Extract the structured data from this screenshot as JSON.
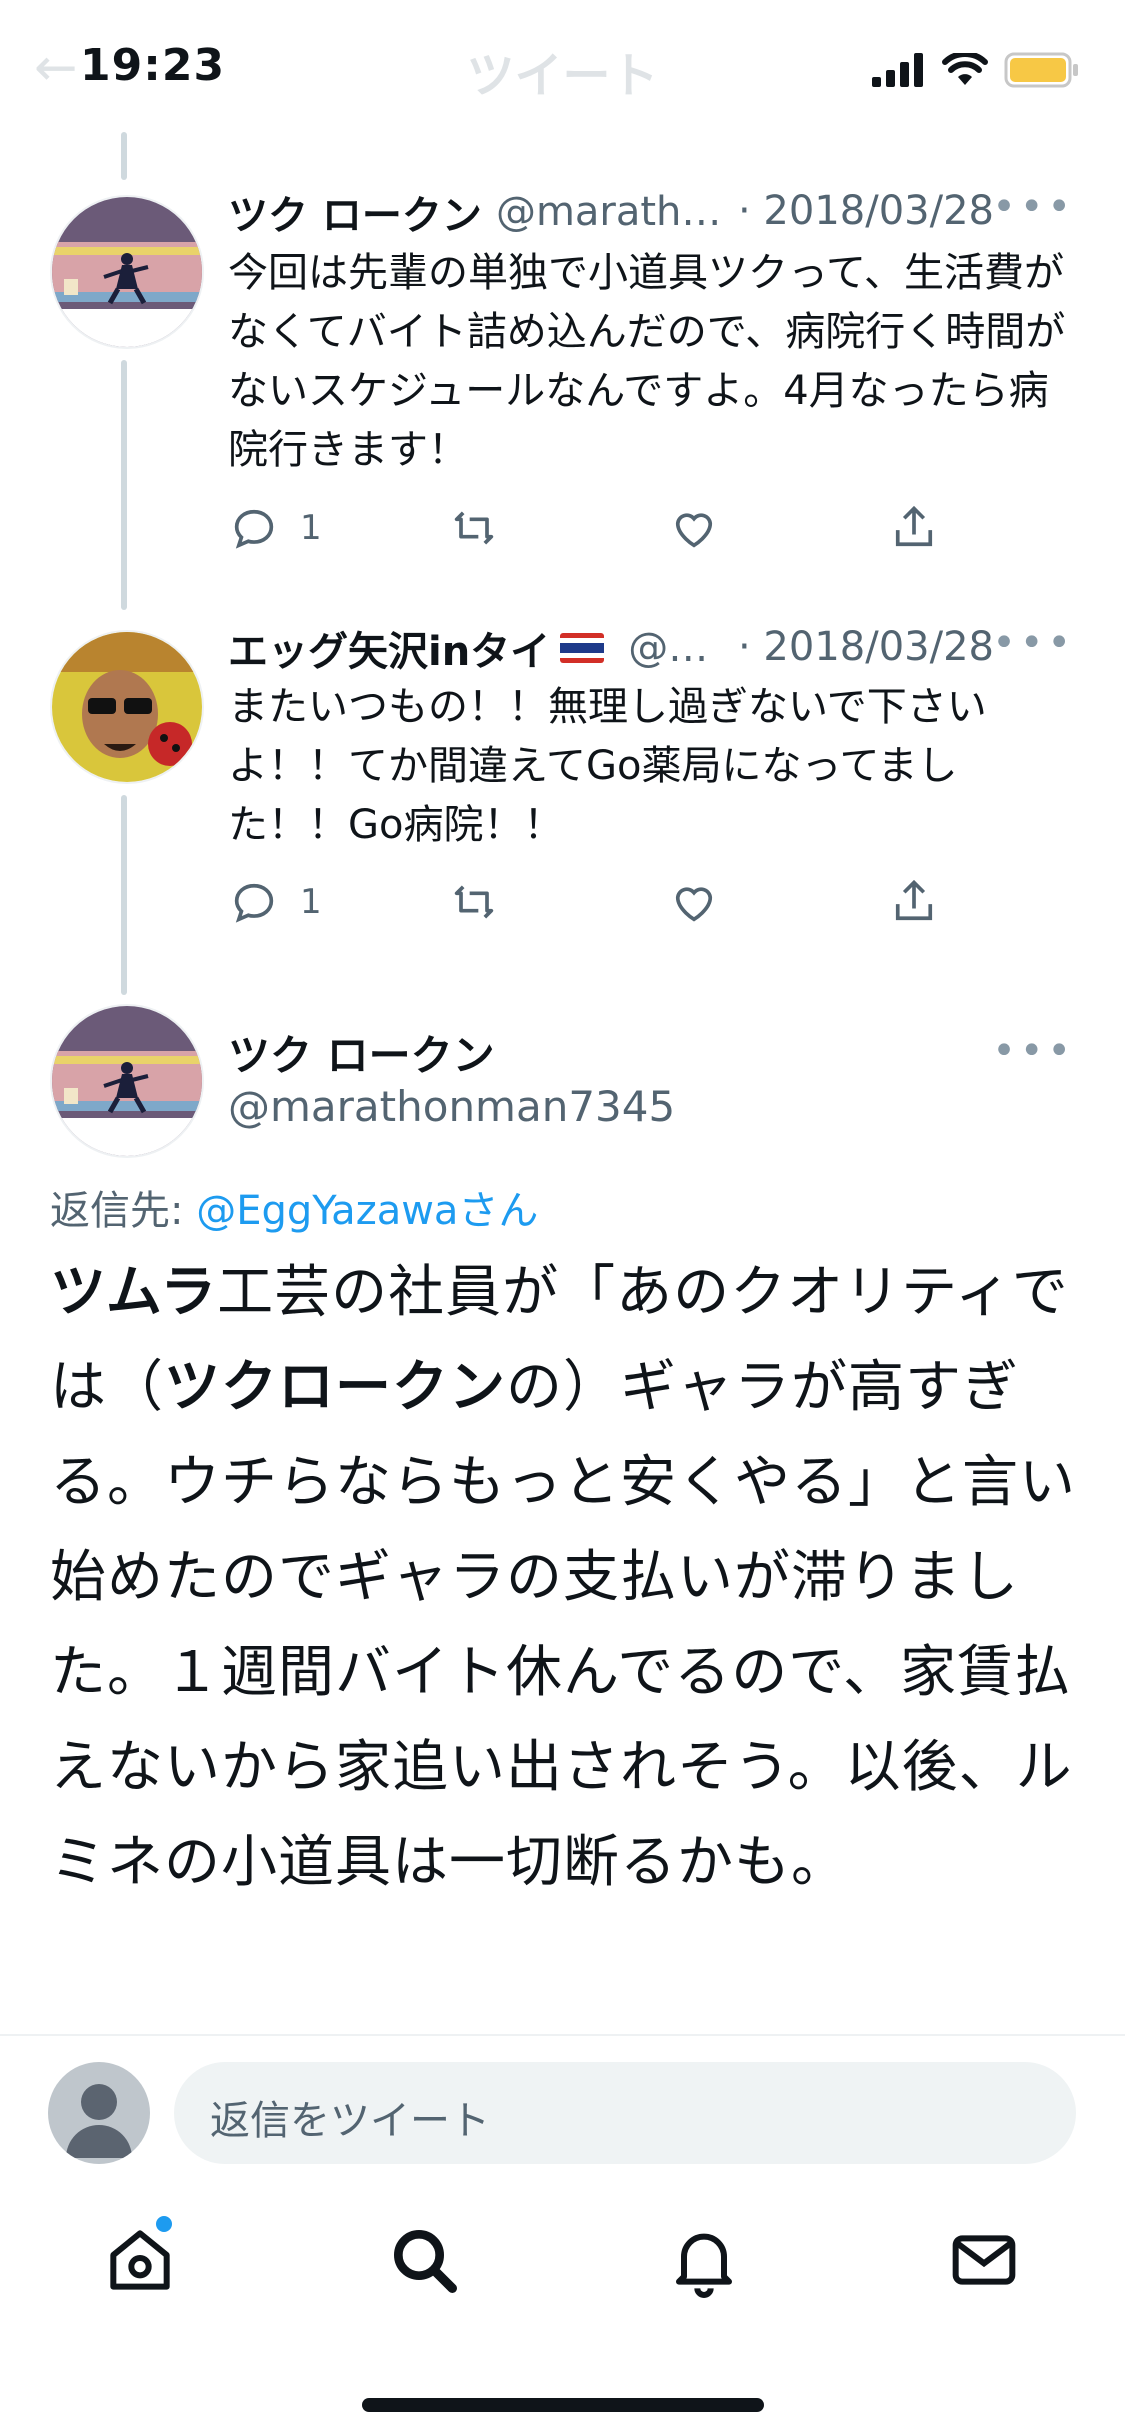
{
  "status_bar": {
    "time": "19:23",
    "ghost_title": "ツイート"
  },
  "tweets": [
    {
      "name": "ツク ロークン",
      "handle": "@marath…",
      "date": "· 2018/03/28",
      "text": "今回は先輩の単独で小道具ツクって、生活費がなくてバイト詰め込んだので、病院行く時間がないスケジュールなんですよ。4月なったら病院行きます！",
      "reply_count": "1"
    },
    {
      "name": "エッグ矢沢inタイ",
      "flag": "🇹🇭",
      "handle": "@…",
      "date": "· 2018/03/28",
      "text": "またいつもの！！無理し過ぎないで下さいよ！！てか間違えてGo薬局になってました！！Go病院！！",
      "reply_count": "1"
    }
  ],
  "main_tweet": {
    "name": "ツク ロークン",
    "handle": "@marathonman7345",
    "reply_to_label": "返信先: ",
    "reply_to_user": "@EggYazawaさん",
    "text_bold_1": "ツムラ",
    "text_1": "工芸の社員が「あのクオリティでは（",
    "text_bold_2": "ツクロークン",
    "text_2": "の）ギャラが高すぎる。ウチらならもっと安くやる」と言い始めたのでギャラの支払いが滞りました。１週間バイト休んでるので、家賃払えないから家追い出されそう。以後、ルミネの小道具は一切断るかも。"
  },
  "reply_bar": {
    "placeholder": "返信をツイート"
  },
  "tab_bar": {
    "items": [
      "home-icon",
      "search-icon",
      "notifications-icon",
      "messages-icon"
    ],
    "home_has_new": true
  },
  "colors": {
    "accent": "#1d9bf0",
    "text": "#0f1419",
    "secondary": "#536471",
    "battery": "#f7c845"
  }
}
